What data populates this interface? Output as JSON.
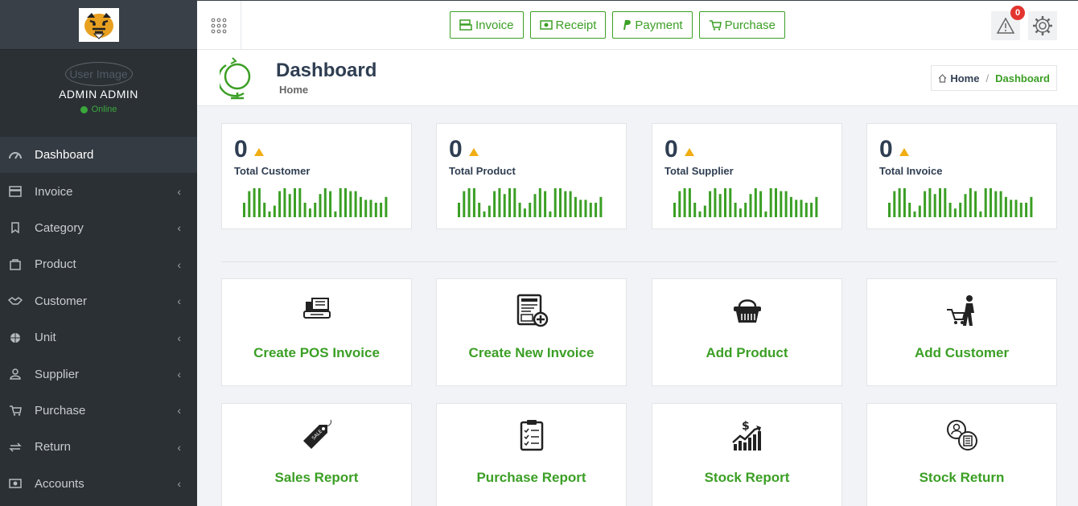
{
  "sidebar": {
    "user_image_alt": "User Image",
    "user_name": "ADMIN ADMIN",
    "status": "Online",
    "items": [
      {
        "label": "Dashboard"
      },
      {
        "label": "Invoice"
      },
      {
        "label": "Category"
      },
      {
        "label": "Product"
      },
      {
        "label": "Customer"
      },
      {
        "label": "Unit"
      },
      {
        "label": "Supplier"
      },
      {
        "label": "Purchase"
      },
      {
        "label": "Return"
      },
      {
        "label": "Accounts"
      }
    ]
  },
  "topbar": {
    "buttons": [
      {
        "label": "Invoice"
      },
      {
        "label": "Receipt"
      },
      {
        "label": "Payment"
      },
      {
        "label": "Purchase"
      }
    ],
    "alert_count": "0"
  },
  "header": {
    "title": "Dashboard",
    "subtitle": "Home",
    "breadcrumb": {
      "home": "Home",
      "current": "Dashboard"
    }
  },
  "stats": [
    {
      "value": "0",
      "label": "Total Customer"
    },
    {
      "value": "0",
      "label": "Total Product"
    },
    {
      "value": "0",
      "label": "Total Supplier"
    },
    {
      "value": "0",
      "label": "Total Invoice"
    }
  ],
  "sparkline_values": [
    5,
    9,
    10,
    10,
    5,
    2,
    4,
    9,
    10,
    8,
    10,
    10,
    5,
    3,
    5,
    8,
    10,
    9,
    2,
    10,
    10,
    9,
    9,
    7,
    6,
    6,
    5,
    5,
    7
  ],
  "tiles": [
    {
      "label": "Create POS Invoice"
    },
    {
      "label": "Create New Invoice"
    },
    {
      "label": "Add Product"
    },
    {
      "label": "Add Customer"
    },
    {
      "label": "Sales Report"
    },
    {
      "label": "Purchase Report"
    },
    {
      "label": "Stock Report"
    },
    {
      "label": "Stock Return"
    }
  ],
  "colors": {
    "accent": "#3b9f25",
    "sidebar": "#2b3035",
    "badge": "#e3342f",
    "warning": "#f0ad14"
  }
}
